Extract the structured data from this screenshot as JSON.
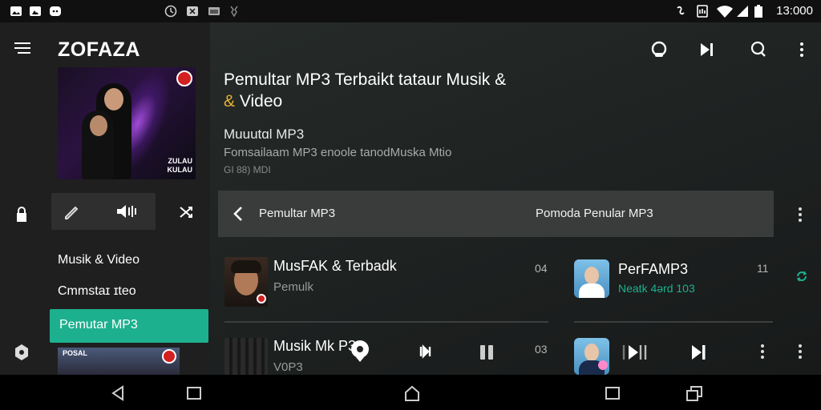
{
  "status_bar": {
    "time": "13:000",
    "left_icons": [
      "image-icon",
      "photo-icon",
      "chat-bubble-icon"
    ],
    "center_icons": [
      "clock-icon",
      "media-icon",
      "cast-icon",
      "bug-icon"
    ],
    "right_icons": [
      "vibrate-icon",
      "sim-icon",
      "wifi-icon",
      "signal-icon",
      "battery-icon"
    ]
  },
  "sidebar": {
    "app_title": "ZOFAZA",
    "album_art_text": "ZULAU\nKULAU",
    "items": [
      {
        "label": "Musik & Video"
      },
      {
        "label": "Cmmstaɪ ɪteo"
      }
    ],
    "active_item": {
      "label": "Pemutar MP3"
    },
    "thumb_text": "POSAL"
  },
  "main": {
    "headline_part1": "Pemultar MP3 Terbaikt tataur Musik &",
    "headline_amp": "&",
    "headline_part2": " Video",
    "subtitle": "Muuutɑl MP3",
    "description": "Fomsailaam MP3 enoole tanodMuska Mtio",
    "meta": "GI 88) MDI",
    "bar": {
      "left_label": "Pemultar MP3",
      "right_label": "Pomoda Penular MP3"
    },
    "rows": [
      {
        "title": "MusFAK & Terbadk",
        "subtitle": "Pemulk",
        "number": "04"
      },
      {
        "title": "PerFAMP3",
        "subtitle": "Neatk 4ǝrd 103",
        "number": "11"
      },
      {
        "title": "Musik Mk P3",
        "subtitle": "V0P3",
        "number": "03"
      }
    ]
  },
  "colors": {
    "accent_green": "#1db08e",
    "amp_gold": "#e6b233",
    "sidebar_bg": "#1f1f1f",
    "main_bg": "#232726"
  }
}
